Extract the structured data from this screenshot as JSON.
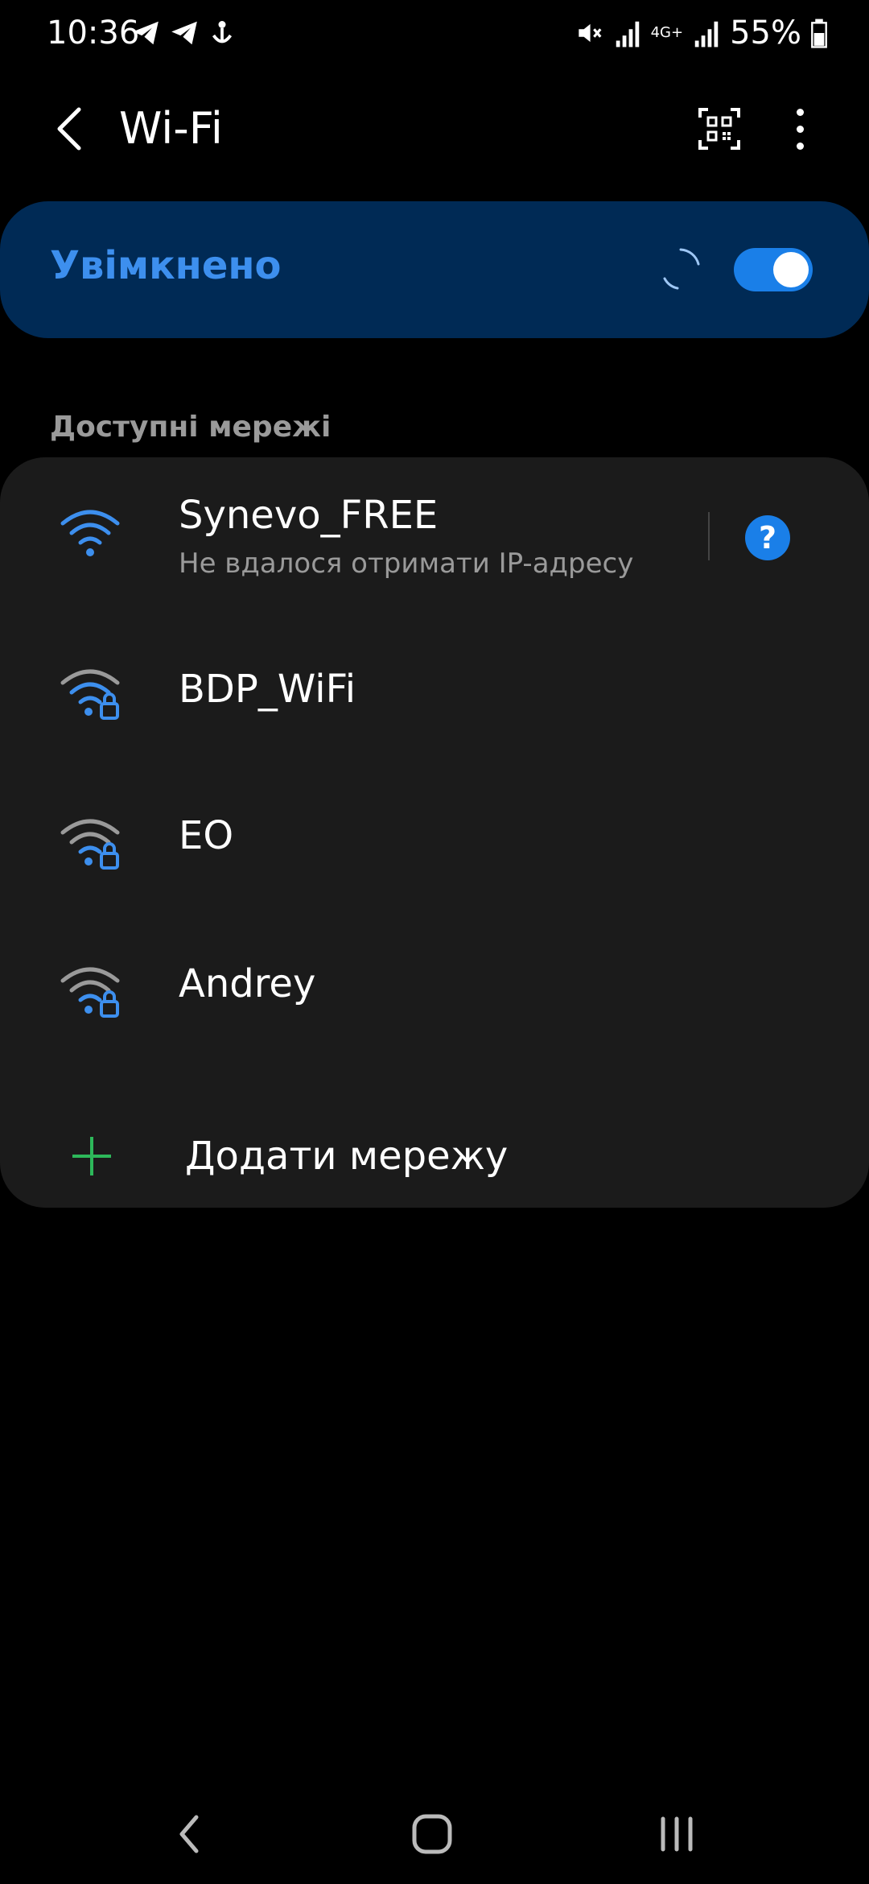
{
  "status_bar": {
    "time": "10:36",
    "battery": "55%",
    "network_type": "4G+"
  },
  "header": {
    "title": "Wi-Fi"
  },
  "master_toggle": {
    "label": "Увімкнено",
    "state": "on",
    "accent_color": "#3d8fee"
  },
  "section": {
    "available_label": "Доступні мережі"
  },
  "networks": [
    {
      "name": "Synevo_FREE",
      "status": "Не вдалося отримати IP-адресу",
      "secured": false,
      "icon": "wifi-icon"
    },
    {
      "name": "BDP_WiFi",
      "secured": true,
      "icon": "wifi-lock-icon"
    },
    {
      "name": "EO",
      "secured": true,
      "icon": "wifi-lock-icon"
    },
    {
      "name": "Andrey",
      "secured": true,
      "icon": "wifi-lock-icon"
    }
  ],
  "add_network": {
    "label": "Додати мережу"
  },
  "help": {
    "glyph": "?"
  }
}
